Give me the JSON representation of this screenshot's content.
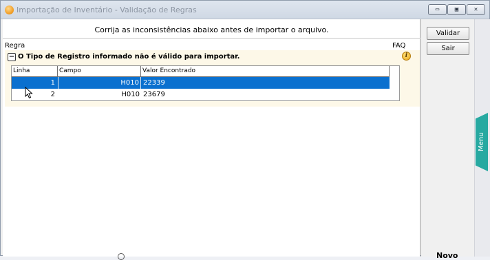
{
  "window": {
    "title": "Importação de Inventário - Validação de Regras",
    "controls": {
      "minimize": "▭",
      "maximize": "▣",
      "close": "✕"
    }
  },
  "main": {
    "instruction": "Corrija as inconsistências abaixo antes de importar o arquivo.",
    "columns": {
      "regra": "Regra",
      "faq": "FAQ"
    },
    "rule": {
      "toggle": "−",
      "title": "O Tipo de Registro informado não é válido para importar.",
      "info_icon": "i"
    },
    "grid": {
      "headers": [
        "Linha",
        "Campo",
        "Valor Encontrado"
      ],
      "rows": [
        {
          "linha": "1",
          "campo": "H010",
          "valor": "22339",
          "selected": true
        },
        {
          "linha": "2",
          "campo": "H010",
          "valor": "23679",
          "selected": false
        }
      ]
    }
  },
  "sidebar": {
    "validar": "Validar",
    "sair": "Sair",
    "menu": "Menu",
    "bottom_clipped": "Novo"
  },
  "colors": {
    "selection": "#0a70cf",
    "rule_background": "#fdf8e8",
    "menu_tab": "#27a9a1"
  }
}
